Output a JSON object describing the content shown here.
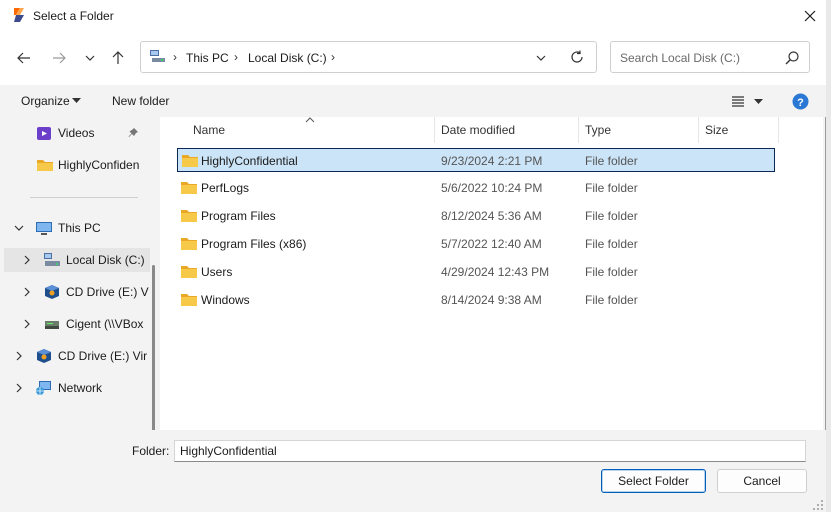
{
  "window": {
    "title": "Select a Folder"
  },
  "nav": {
    "breadcrumbs": [
      "This PC",
      "Local Disk (C:)"
    ],
    "search_placeholder": "Search Local Disk (C:)"
  },
  "toolbar": {
    "organize": "Organize",
    "new_folder": "New folder"
  },
  "tree": {
    "quick": [
      {
        "label": "Videos",
        "icon": "videos-folder-icon",
        "pinned": true
      },
      {
        "label": "HighlyConfiden",
        "icon": "folder-icon"
      }
    ],
    "this_pc": "This PC",
    "local_disk": "Local Disk (C:)",
    "cd_drive_sub": "CD Drive (E:) V",
    "cigent": "Cigent (\\\\VBox",
    "cd_drive": "CD Drive (E:) Vir",
    "network": "Network"
  },
  "columns": {
    "name": "Name",
    "date": "Date modified",
    "type": "Type",
    "size": "Size"
  },
  "files": [
    {
      "name": "HighlyConfidential",
      "date": "9/23/2024 2:21 PM",
      "type": "File folder",
      "selected": true
    },
    {
      "name": "PerfLogs",
      "date": "5/6/2022 10:24 PM",
      "type": "File folder"
    },
    {
      "name": "Program Files",
      "date": "8/12/2024 5:36 AM",
      "type": "File folder"
    },
    {
      "name": "Program Files (x86)",
      "date": "5/7/2022 12:40 AM",
      "type": "File folder"
    },
    {
      "name": "Users",
      "date": "4/29/2024 12:43 PM",
      "type": "File folder"
    },
    {
      "name": "Windows",
      "date": "8/14/2024 9:38 AM",
      "type": "File folder"
    }
  ],
  "footer": {
    "folder_label": "Folder:",
    "folder_value": "HighlyConfidential",
    "select_button": "Select Folder",
    "cancel_button": "Cancel"
  },
  "colors": {
    "accent": "#005fb8",
    "selection": "#cce4f7",
    "folder": "#f2c14e"
  }
}
